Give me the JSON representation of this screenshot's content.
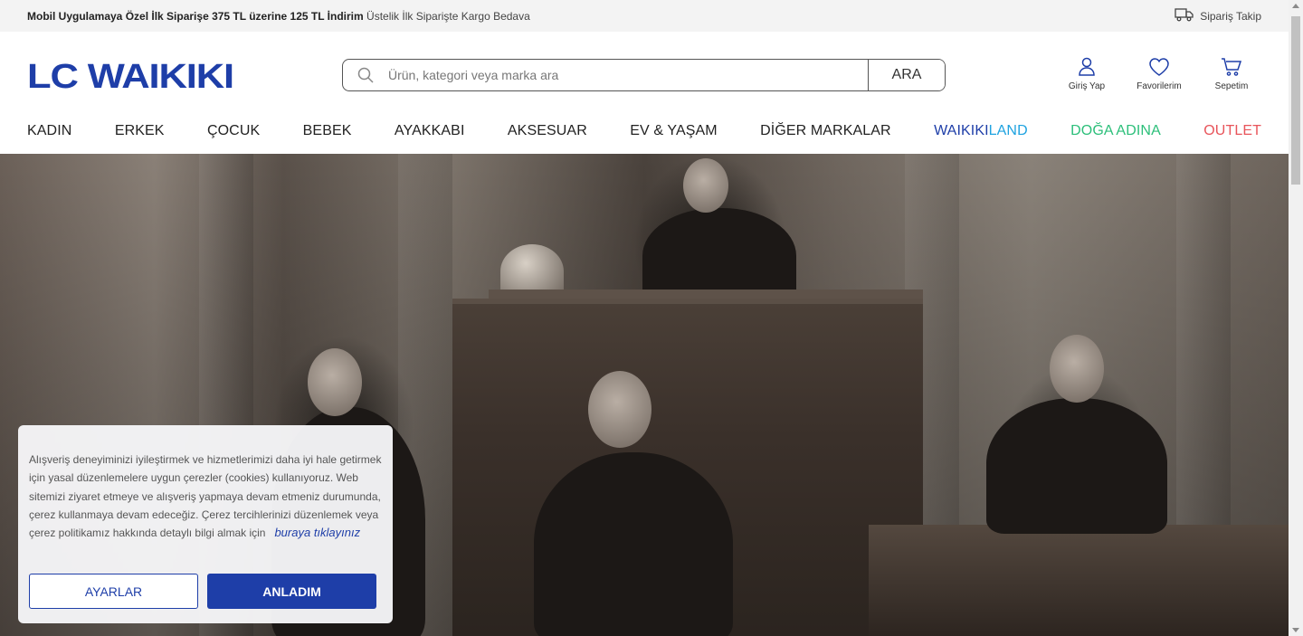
{
  "topbar": {
    "promo_bold": "Mobil Uygulamaya Özel İlk Siparişe 375 TL üzerine 125 TL İndirim",
    "promo_rest": "Üstelik İlk Siparişte Kargo Bedava",
    "track_label": "Sipariş Takip"
  },
  "header": {
    "logo_text": "LC WAIKIKI",
    "search_placeholder": "Ürün, kategori veya marka ara",
    "search_button": "ARA",
    "login_label": "Giriş Yap",
    "favorites_label": "Favorilerim",
    "cart_label": "Sepetim"
  },
  "nav": {
    "items": [
      "KADIN",
      "ERKEK",
      "ÇOCUK",
      "BEBEK",
      "AYAKKABI",
      "AKSESUAR",
      "EV & YAŞAM",
      "DİĞER MARKALAR"
    ],
    "waikikiland_part1": "WAIKIKI",
    "waikikiland_part2": "LAND",
    "doga": "DOĞA ADINA",
    "outlet": "OUTLET"
  },
  "cookie": {
    "text": "Alışveriş deneyiminizi iyileştirmek ve hizmetlerimizi daha iyi hale getirmek için yasal düzenlemelere uygun çerezler (cookies) kullanıyoruz. Web sitemizi ziyaret etmeye ve alışveriş yapmaya devam etmeniz durumunda, çerez kullanmaya devam edeceğiz. Çerez tercihlerinizi düzenlemek veya çerez politikamız hakkında detaylı bilgi almak için",
    "link": "buraya tıklayınız",
    "settings_button": "AYARLAR",
    "accept_button": "ANLADIM"
  },
  "colors": {
    "brand_blue": "#1e3ea8",
    "waikikiland_light": "#1fa3e0",
    "doga_green": "#2cbf7a",
    "outlet_red": "#e8555b"
  }
}
